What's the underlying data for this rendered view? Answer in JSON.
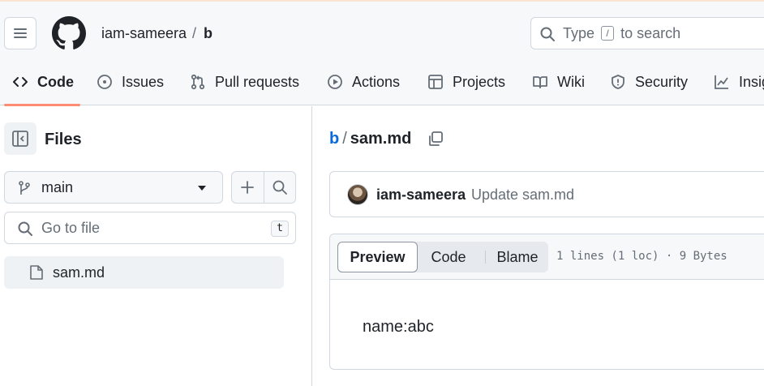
{
  "repo": {
    "owner": "iam-sameera",
    "separator": "/",
    "name": "b"
  },
  "search": {
    "prefix": "Type",
    "key": "/",
    "suffix": "to search"
  },
  "tabs": [
    {
      "label": "Code",
      "icon": "code-icon"
    },
    {
      "label": "Issues",
      "icon": "issue-icon"
    },
    {
      "label": "Pull requests",
      "icon": "pull-request-icon"
    },
    {
      "label": "Actions",
      "icon": "play-icon"
    },
    {
      "label": "Projects",
      "icon": "table-icon"
    },
    {
      "label": "Wiki",
      "icon": "book-icon"
    },
    {
      "label": "Security",
      "icon": "shield-icon"
    },
    {
      "label": "Insights",
      "icon": "graph-icon"
    }
  ],
  "sidebar": {
    "title": "Files",
    "branch": "main",
    "goto_placeholder": "Go to file",
    "goto_key": "t",
    "files": [
      {
        "name": "sam.md",
        "icon": "file-icon"
      }
    ]
  },
  "breadcrumb": {
    "repo": "b",
    "separator": "/",
    "file": "sam.md"
  },
  "commit": {
    "author": "iam-sameera",
    "message": "Update sam.md"
  },
  "viewer": {
    "modes": [
      "Preview",
      "Code",
      "Blame"
    ],
    "active_mode": "Preview",
    "info": "1 lines (1 loc) · 9 Bytes",
    "content": "name:abc"
  },
  "colors": {
    "link": "#0969da",
    "active_tab_underline": "#fd8c73",
    "border": "#d0d7de"
  }
}
